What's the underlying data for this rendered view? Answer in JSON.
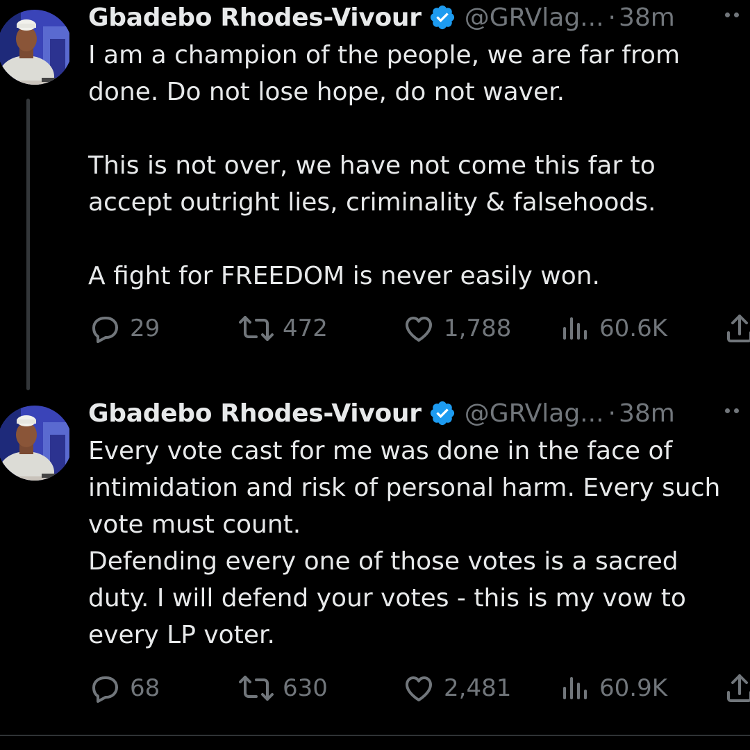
{
  "tweets": [
    {
      "author_name": "Gbadebo Rhodes-Vivour",
      "handle": "@GRVlag...",
      "separator": "·",
      "time": "38m",
      "verified_icon": "verified-badge-icon",
      "lines": [
        "I am a champion of the people, we are far from",
        "done. Do not lose hope, do not waver.",
        "",
        "This is not over, we have not come this far to",
        "accept outright lies, criminality & falsehoods.",
        "",
        "A fight for FREEDOM is never easily won."
      ],
      "stats": {
        "replies": "29",
        "reposts": "472",
        "likes": "1,788",
        "views": "60.6K"
      }
    },
    {
      "author_name": "Gbadebo Rhodes-Vivour",
      "handle": "@GRVlag...",
      "separator": "·",
      "time": "38m",
      "verified_icon": "verified-badge-icon",
      "lines": [
        "Every vote cast for me was done in the face of",
        "intimidation and risk of personal harm. Every such",
        "vote must count.",
        "Defending every one of those votes is a sacred",
        "duty. I will defend your votes - this is my vow to",
        "every LP voter."
      ],
      "stats": {
        "replies": "68",
        "reposts": "630",
        "likes": "2,481",
        "views": "60.9K"
      }
    }
  ],
  "colors": {
    "background": "#000000",
    "text_primary": "#e7e9ea",
    "text_secondary": "#71767b",
    "verified_blue": "#1d9bf0",
    "thread_line": "#333639"
  },
  "icons": [
    "reply-icon",
    "repost-icon",
    "like-icon",
    "views-icon",
    "share-icon",
    "more-icon",
    "verified-badge-icon"
  ]
}
